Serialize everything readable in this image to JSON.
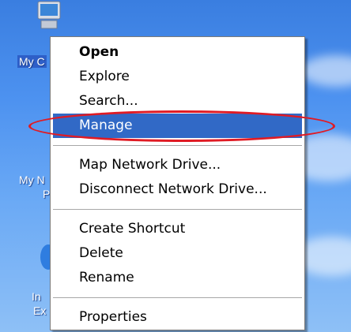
{
  "desktop": {
    "icons": [
      {
        "label": "My C",
        "icon": "my-computer-icon"
      },
      {
        "label": "My N",
        "label2": "P",
        "icon": "my-network-places-icon"
      },
      {
        "label": "In",
        "label2": "Ex",
        "icon": "internet-explorer-icon"
      }
    ]
  },
  "context_menu": {
    "items": [
      {
        "label": "Open"
      },
      {
        "label": "Explore"
      },
      {
        "label": "Search..."
      },
      {
        "label": "Manage"
      },
      {
        "label": "Map Network Drive..."
      },
      {
        "label": "Disconnect Network Drive..."
      },
      {
        "label": "Create Shortcut"
      },
      {
        "label": "Delete"
      },
      {
        "label": "Rename"
      },
      {
        "label": "Properties"
      }
    ],
    "highlight_color": "#3169c6"
  },
  "annotation": {
    "color": "#e01b24",
    "shape": "ellipse"
  }
}
